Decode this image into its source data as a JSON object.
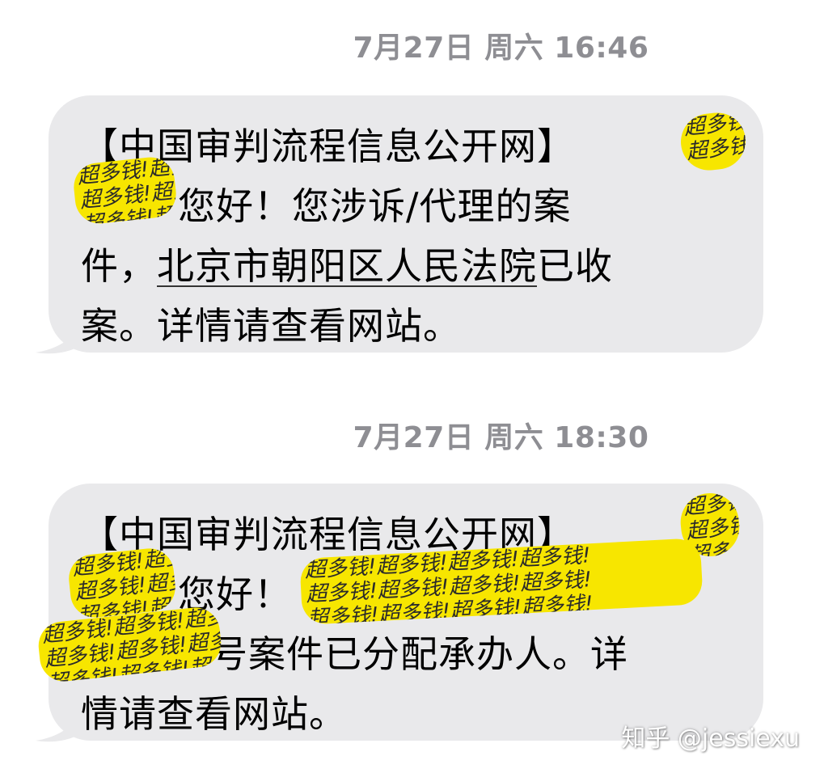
{
  "colors": {
    "bubble_background": "#e9e9eb",
    "timestamp_text": "#8e8e93",
    "redaction_highlight": "#f7e600"
  },
  "messages": [
    {
      "timestamp": "7月27日 周六 16:46",
      "lines": [
        "【中国审判流程信息公开网】",
        "您好！您涉诉/代理的案",
        "件，",
        "北京市朝阳区人民法院",
        "已收",
        "案。详情请查看网站。"
      ]
    },
    {
      "timestamp": "7月27日 周六 18:30",
      "lines": [
        "【中国审判流程信息公开网】",
        "您好！",
        "号案件已分配承办人。详",
        "情请查看网站。"
      ]
    }
  ],
  "redaction_text": "超多钱!超多钱!超多钱!超多钱!",
  "watermark": "知乎 @jessiexu"
}
